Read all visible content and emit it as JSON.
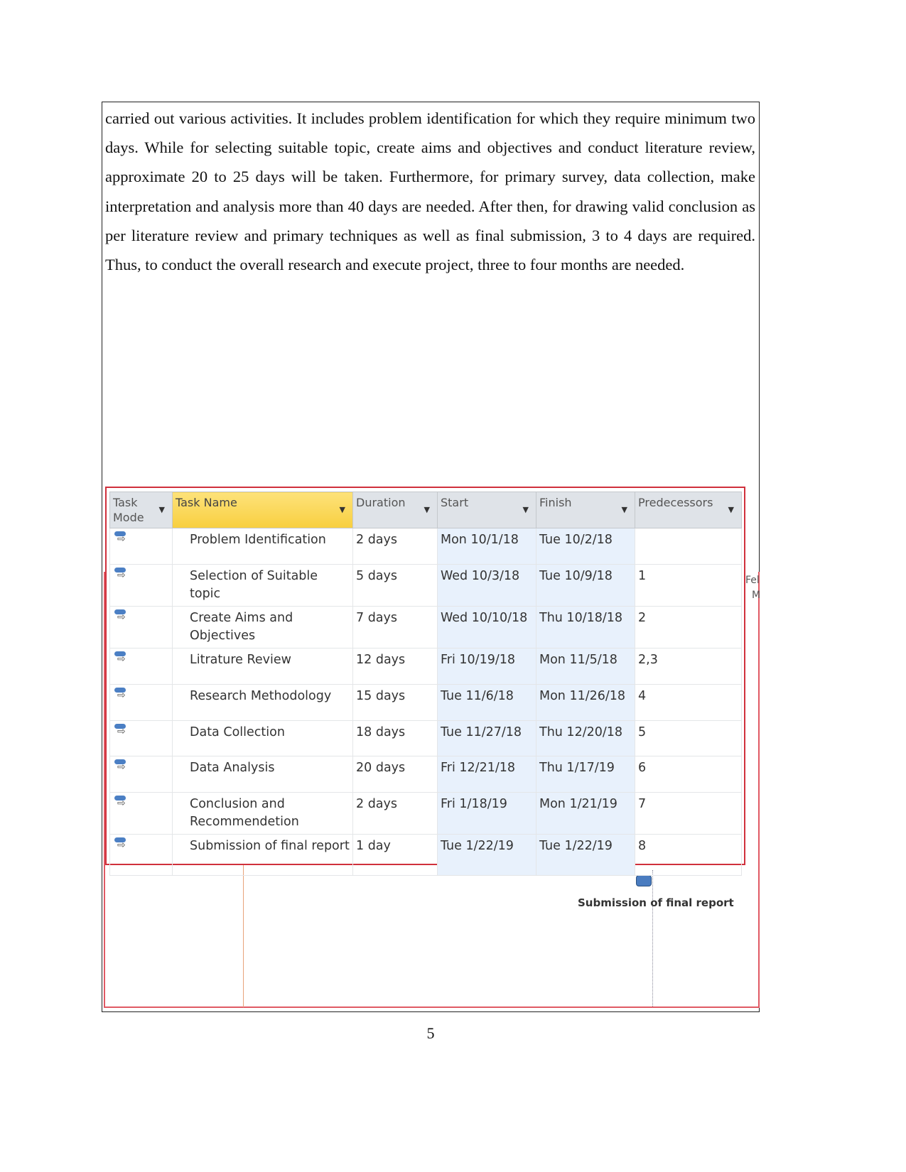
{
  "paragraph": "carried out various activities. It includes problem identification for which they require minimum two days. While for selecting suitable topic, create aims and objectives and conduct literature review, approximate 20 to 25 days will be taken. Furthermore, for primary survey, data collection, make interpretation and analysis more than 40 days are needed. After then, for drawing valid conclusion as per literature review and primary techniques as well as final submission, 3 to 4 days are required. Thus, to conduct the overall research and execute project, three to four months are needed.",
  "table": {
    "headers": [
      "Task Mode",
      "Task Name",
      "Duration",
      "Start",
      "Finish",
      "Predecessors"
    ],
    "rows": [
      {
        "name": "Problem Identification",
        "duration": "2 days",
        "start": "Mon 10/1/18",
        "finish": "Tue 10/2/18",
        "pred": ""
      },
      {
        "name": "Selection of Suitable topic",
        "duration": "5 days",
        "start": "Wed 10/3/18",
        "finish": "Tue 10/9/18",
        "pred": "1"
      },
      {
        "name": "Create Aims and Objectives",
        "duration": "7 days",
        "start": "Wed 10/10/18",
        "finish": "Thu 10/18/18",
        "pred": "2"
      },
      {
        "name": "Litrature Review",
        "duration": "12 days",
        "start": "Fri 10/19/18",
        "finish": "Mon 11/5/18",
        "pred": "2,3"
      },
      {
        "name": "Research Methodology",
        "duration": "15 days",
        "start": "Tue 11/6/18",
        "finish": "Mon 11/26/18",
        "pred": "4"
      },
      {
        "name": "Data Collection",
        "duration": "18 days",
        "start": "Tue 11/27/18",
        "finish": "Thu 12/20/18",
        "pred": "5"
      },
      {
        "name": "Data Analysis",
        "duration": "20 days",
        "start": "Fri 12/21/18",
        "finish": "Thu 1/17/19",
        "pred": "6"
      },
      {
        "name": "Conclusion and Recommendetion",
        "duration": "2 days",
        "start": "Fri 1/18/19",
        "finish": "Mon 1/21/19",
        "pred": "7"
      },
      {
        "name": "Submission of final report",
        "duration": "1 day",
        "start": "Tue 1/22/19",
        "finish": "Tue 1/22/19",
        "pred": "8"
      }
    ]
  },
  "gantt": {
    "milestone_label": "Submission of final report",
    "fragment_top": "Fel",
    "fragment_bottom": "M"
  },
  "page_number": "5",
  "colors": {
    "header_highlight": "#f8cf3f",
    "date_column_bg": "#e8f1fc",
    "border_red": "#d0303c",
    "task_bar": "#4b7fc4"
  }
}
